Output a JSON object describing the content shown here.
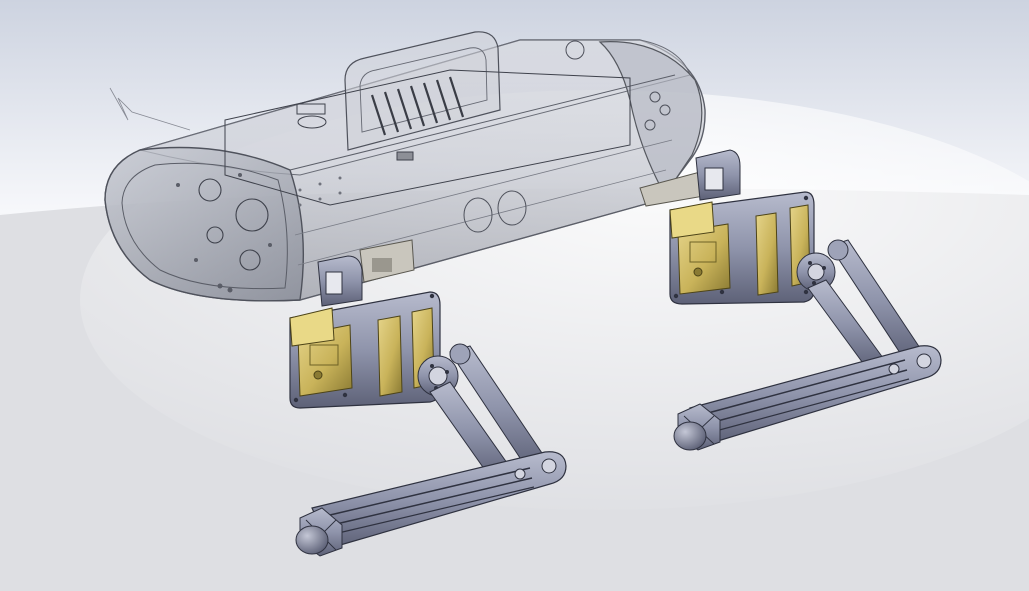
{
  "viewport": {
    "content": "cad-3d-model-view",
    "background_colors": {
      "top": "#cdd3e0",
      "horizon": "#f7f8fb",
      "floor": "#dfe0e3"
    }
  },
  "model": {
    "render_style": "translucent-shell-with-shaded-parts",
    "colors": {
      "shell_fill": "#c3c6cf",
      "shell_edge": "#5c5f69",
      "leg_fill": "#8f94ab",
      "leg_light": "#b7bbcd",
      "leg_dark": "#5d6177",
      "leg_edge": "#2f3240",
      "servo_fill": "#c9b35a",
      "servo_light": "#e5d48a",
      "servo_dark": "#8a7a33",
      "bracket_fill": "#c9c6bd"
    },
    "visible_legs": 2
  }
}
